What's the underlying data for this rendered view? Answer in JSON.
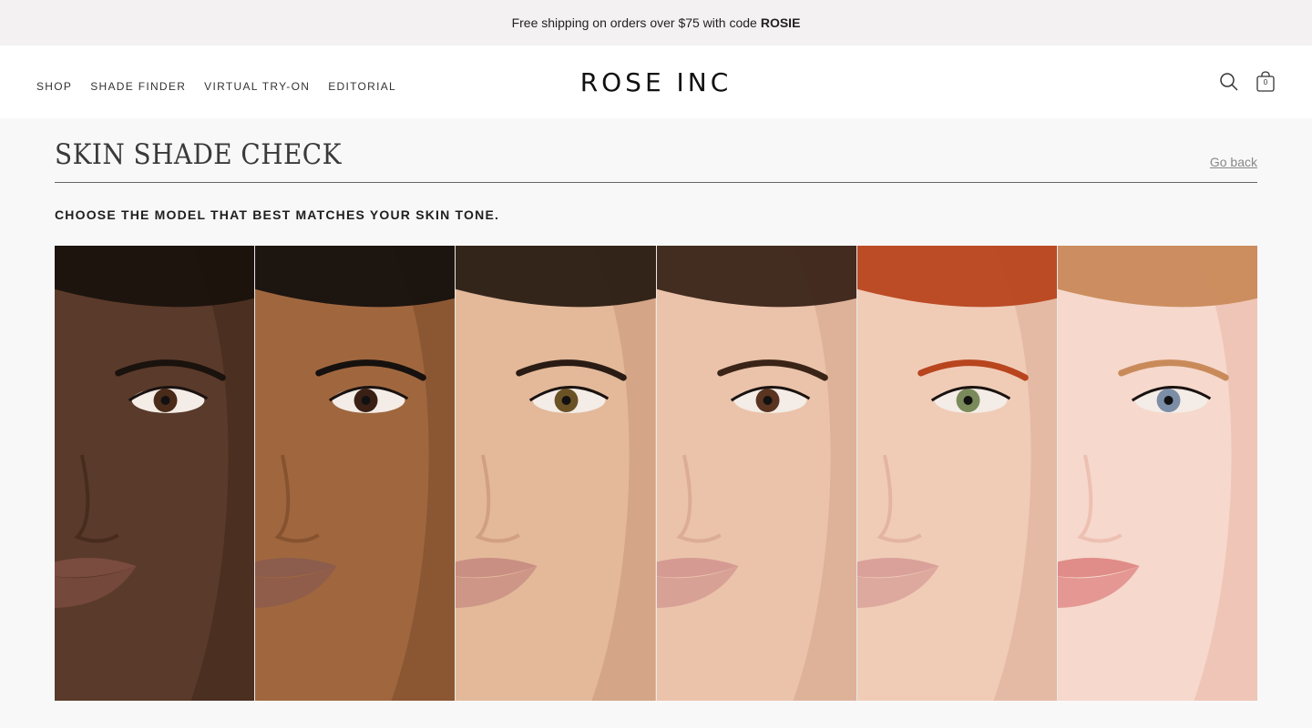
{
  "promo": {
    "text": "Free shipping on orders over $75 with code",
    "code": "ROSIE"
  },
  "nav": {
    "items": [
      {
        "label": "SHOP"
      },
      {
        "label": "SHADE FINDER"
      },
      {
        "label": "VIRTUAL TRY-ON"
      },
      {
        "label": "EDITORIAL"
      }
    ]
  },
  "brand": {
    "logo": "ROSE INC"
  },
  "cart": {
    "count": "0"
  },
  "icons": {
    "search": "search-icon",
    "cart": "bag-icon"
  },
  "page": {
    "title": "SKIN SHADE CHECK",
    "go_back": "Go back",
    "instruction": "CHOOSE THE MODEL THAT BEST MATCHES YOUR SKIN TONE."
  },
  "models": [
    {
      "skin": "#5a3a2a",
      "shade": "#3f2619",
      "lip": "#7a4b3f",
      "hair": "#1a120d",
      "iris": "#4a2a18",
      "bg": "#e6c7b3"
    },
    {
      "skin": "#a0673f",
      "shade": "#7a4a2a",
      "lip": "#8c5c4c",
      "hair": "#16110e",
      "iris": "#3a2014",
      "bg": "#e2e0df"
    },
    {
      "skin": "#e3b99a",
      "shade": "#c99576",
      "lip": "#c98f83",
      "hair": "#2a1c14",
      "iris": "#6b5225",
      "bg": "#ededeb"
    },
    {
      "skin": "#ebc3aa",
      "shade": "#d4a48a",
      "lip": "#d59b93",
      "hair": "#3a2418",
      "iris": "#5a3420",
      "bg": "#e3e1df"
    },
    {
      "skin": "#f0ccb7",
      "shade": "#ddab95",
      "lip": "#d9a19a",
      "hair": "#b8451e",
      "iris": "#7a8a5a",
      "bg": "#e8e7e6"
    },
    {
      "skin": "#f6d8cc",
      "shade": "#eab6a6",
      "lip": "#e08c88",
      "hair": "#c98a5a",
      "iris": "#7c8ea6",
      "bg": "#efe9e6"
    }
  ]
}
